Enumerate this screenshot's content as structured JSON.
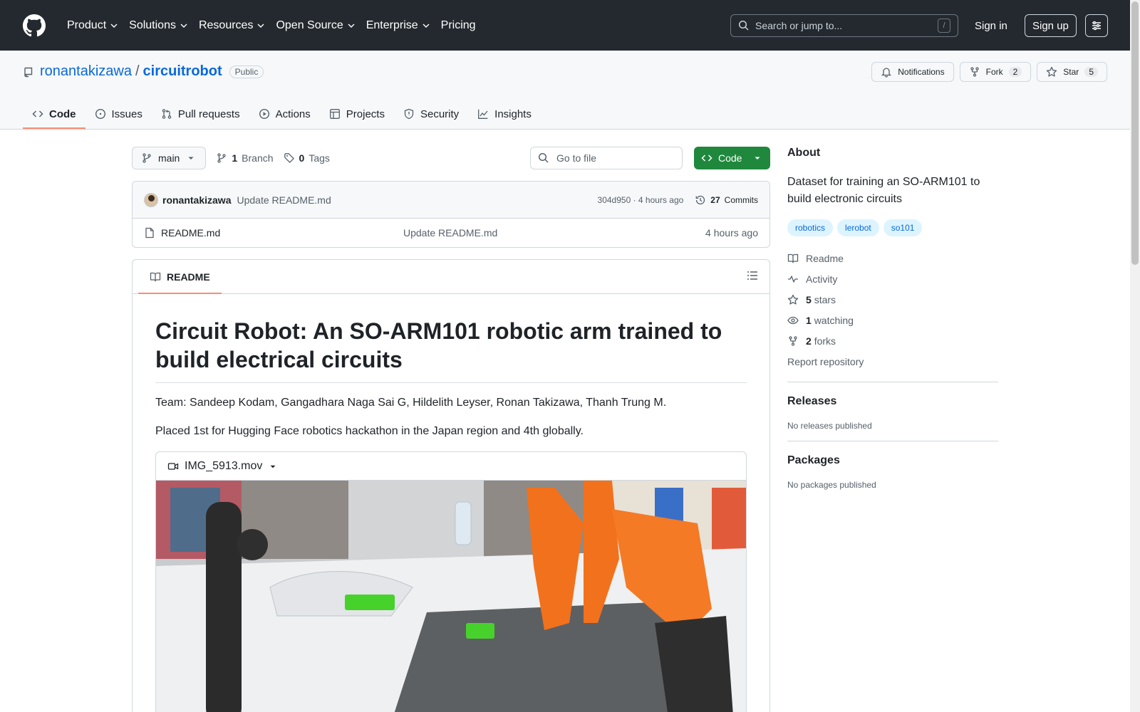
{
  "header": {
    "nav": [
      "Product",
      "Solutions",
      "Resources",
      "Open Source",
      "Enterprise",
      "Pricing"
    ],
    "search_placeholder": "Search or jump to...",
    "search_shortcut": "/",
    "sign_in": "Sign in",
    "sign_up": "Sign up"
  },
  "repo": {
    "owner": "ronantakizawa",
    "separator": "/",
    "name": "circuitrobot",
    "visibility": "Public",
    "notifications_label": "Notifications",
    "fork_label": "Fork",
    "fork_count": "2",
    "star_label": "Star",
    "star_count": "5",
    "tabs": [
      "Code",
      "Issues",
      "Pull requests",
      "Actions",
      "Projects",
      "Security",
      "Insights"
    ]
  },
  "file_nav": {
    "branch": "main",
    "branch_count": "1",
    "branch_label": "Branch",
    "tag_count": "0",
    "tag_label": "Tags",
    "goto_placeholder": "Go to file",
    "code_label": "Code"
  },
  "commit": {
    "author": "ronantakizawa",
    "message": "Update README.md",
    "meta": "304d950 · 4 hours ago",
    "commits_count": "27",
    "commits_label": "Commits"
  },
  "files": [
    {
      "name": "README.md",
      "message": "Update README.md",
      "date": "4 hours ago"
    }
  ],
  "readme": {
    "tab_label": "README",
    "title": "Circuit Robot: An SO-ARM101 robotic arm trained to build electrical circuits",
    "team": "Team: Sandeep Kodam, Gangadhara Naga Sai G, Hildelith Leyser, Ronan Takizawa, Thanh Trung M.",
    "placement": "Placed 1st for Hugging Face robotics hackathon in the Japan region and 4th globally.",
    "video_name": "IMG_5913.mov"
  },
  "about": {
    "heading": "About",
    "description": "Dataset for training an SO-ARM101 to build electronic circuits",
    "topics": [
      "robotics",
      "lerobot",
      "so101"
    ],
    "readme_label": "Readme",
    "activity_label": "Activity",
    "stars_count": "5",
    "stars_label": "stars",
    "watching_count": "1",
    "watching_label": "watching",
    "forks_count": "2",
    "forks_label": "forks",
    "report_label": "Report repository"
  },
  "releases": {
    "heading": "Releases",
    "empty": "No releases published"
  },
  "packages": {
    "heading": "Packages",
    "empty": "No packages published"
  },
  "colors": {
    "header_bg": "#24292f",
    "link": "#0969da",
    "code_button": "#1f883d",
    "tab_underline": "#fd8c73"
  }
}
